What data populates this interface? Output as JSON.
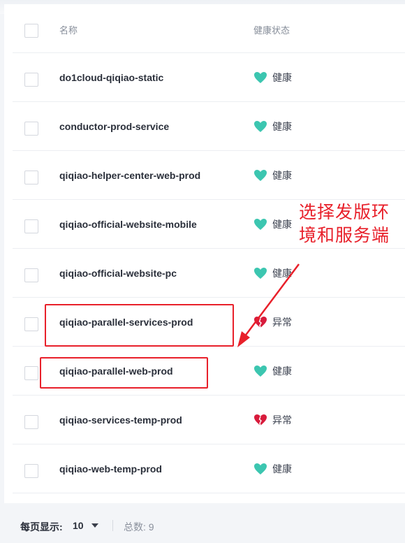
{
  "table": {
    "header": {
      "name": "名称",
      "status": "健康状态"
    },
    "rows": [
      {
        "name": "do1cloud-qiqiao-static",
        "status": "健康",
        "healthy": true
      },
      {
        "name": "conductor-prod-service",
        "status": "健康",
        "healthy": true
      },
      {
        "name": "qiqiao-helper-center-web-prod",
        "status": "健康",
        "healthy": true
      },
      {
        "name": "qiqiao-official-website-mobile",
        "status": "健康",
        "healthy": true
      },
      {
        "name": "qiqiao-official-website-pc",
        "status": "健康",
        "healthy": true
      },
      {
        "name": "qiqiao-parallel-services-prod",
        "status": "异常",
        "healthy": false
      },
      {
        "name": "qiqiao-parallel-web-prod",
        "status": "健康",
        "healthy": true
      },
      {
        "name": "qiqiao-services-temp-prod",
        "status": "异常",
        "healthy": false
      },
      {
        "name": "qiqiao-web-temp-prod",
        "status": "健康",
        "healthy": true
      }
    ]
  },
  "pagination": {
    "page_size_label": "每页显示:",
    "page_size_value": "10",
    "total_text": "总数: 9"
  },
  "annotation": {
    "line1": "选择发版环",
    "line2": "境和服务端"
  },
  "colors": {
    "healthy": "#3cc6b0",
    "unhealthy": "#d81b3c",
    "annotation": "#e8202a"
  }
}
